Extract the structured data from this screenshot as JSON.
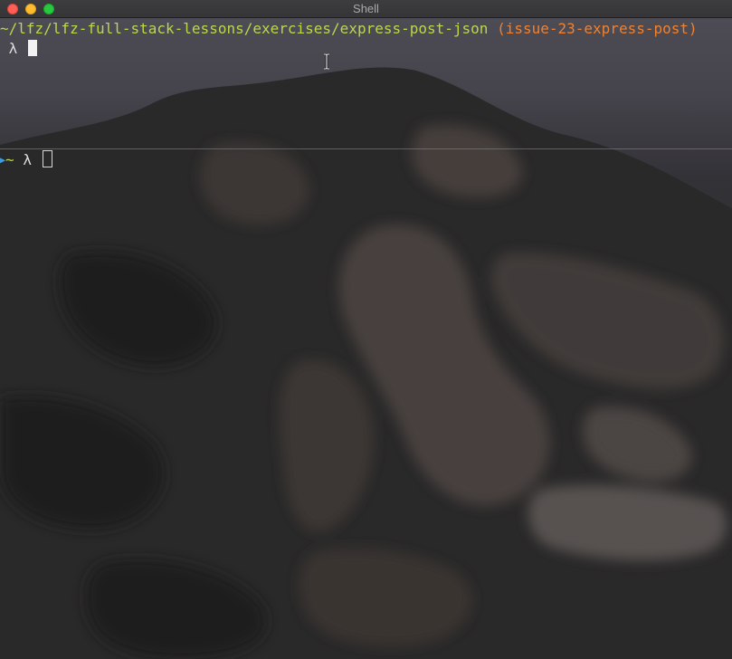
{
  "window": {
    "title": "Shell"
  },
  "panes": {
    "top": {
      "path": "~/lfz/lfz-full-stack-lessons/exercises/express-post-json",
      "branch": "(issue-23-express-post)",
      "prompt": "λ"
    },
    "bottom": {
      "active_indicator": "▶",
      "path": "~",
      "prompt": "λ"
    }
  },
  "colors": {
    "path": "#b9d84a",
    "branch": "#f0812f",
    "prompt": "#dcdcdc",
    "indicator": "#3aa0e6"
  },
  "icons": {
    "window_controls": [
      "close-icon",
      "minimize-icon",
      "maximize-icon"
    ],
    "pointer": "text-cursor-icon"
  }
}
